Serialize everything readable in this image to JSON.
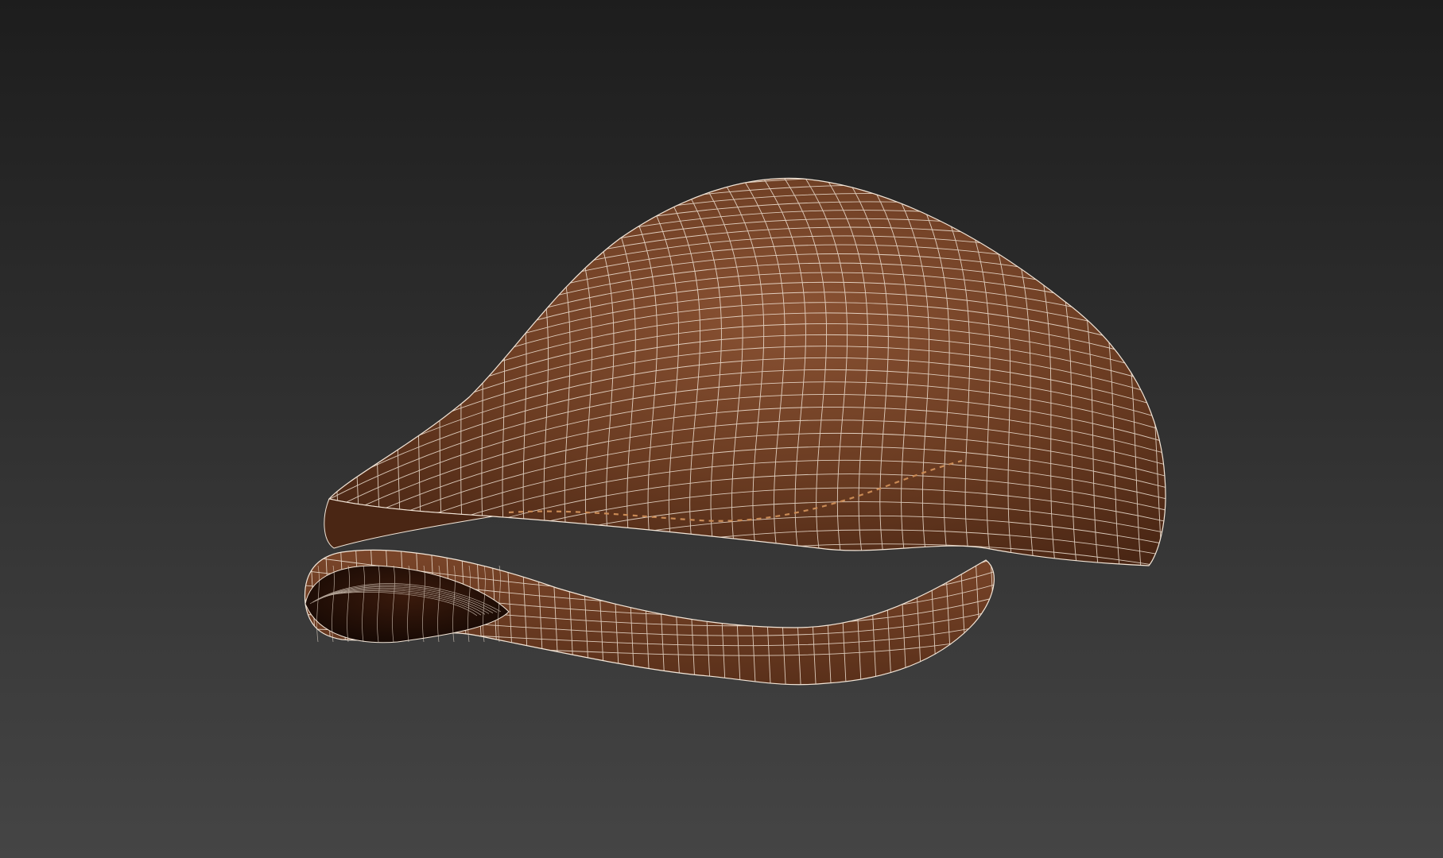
{
  "viewport": {
    "label": "",
    "background_top": "#1d1d1d",
    "background_bottom": "#454545"
  },
  "model": {
    "name": "",
    "object": "flat-cap-icon",
    "shading": "textured-with-wireframe",
    "colors": {
      "crown_light": "#8a5233",
      "crown_mid": "#6b3c22",
      "crown_dark": "#4a2614",
      "brim": "#7a4529",
      "underside": "#1a0c06",
      "wire": "#f3e6d8",
      "stitch": "#c98a55"
    }
  }
}
